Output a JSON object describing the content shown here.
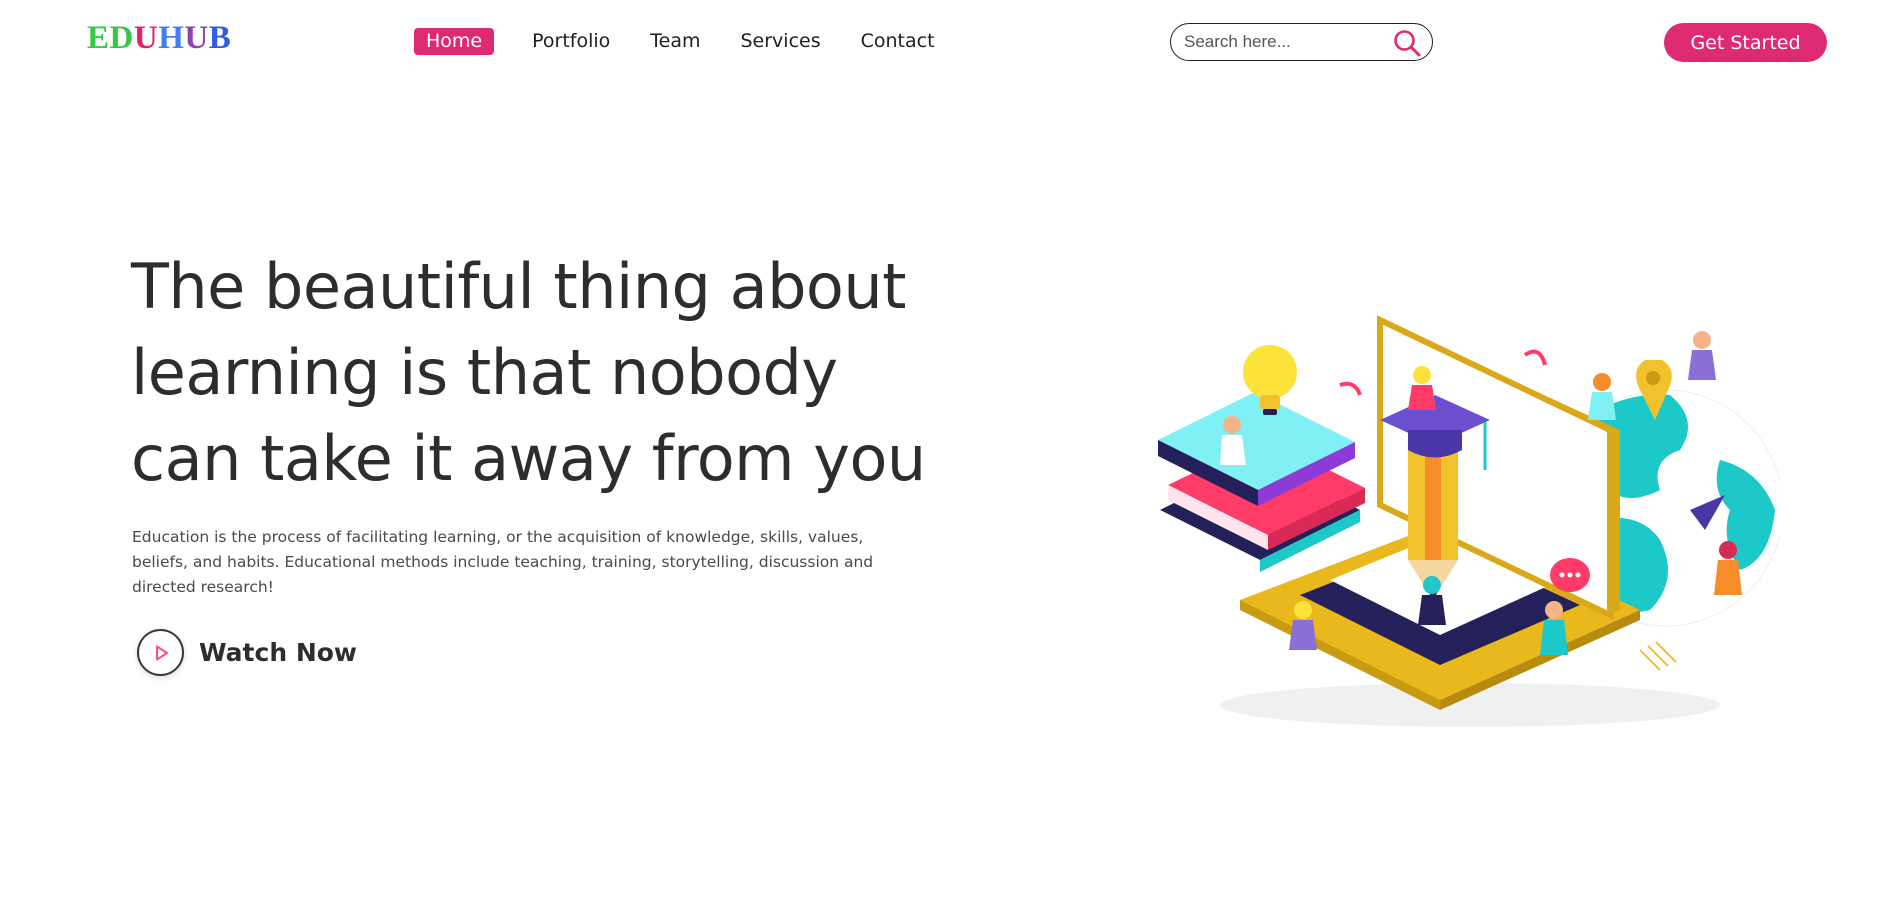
{
  "header": {
    "logo": [
      "E",
      "D",
      "U",
      "H",
      "U",
      "B"
    ],
    "logo_colors": [
      "#2ecc40",
      "#34c84a",
      "#e91e63",
      "#3f7ef5",
      "#8e44ad",
      "#2e5be8"
    ],
    "nav": [
      {
        "label": "Home",
        "active": true
      },
      {
        "label": "Portfolio",
        "active": false
      },
      {
        "label": "Team",
        "active": false
      },
      {
        "label": "Services",
        "active": false
      },
      {
        "label": "Contact",
        "active": false
      }
    ],
    "search_placeholder": "Search here...",
    "cta_label": "Get Started"
  },
  "hero": {
    "title_lines": [
      "The beautiful thing about",
      "learning is that nobody",
      "can take it away from you"
    ],
    "description": "Education is the process of facilitating learning, or the acquisition of knowledge, skills, values, beliefs, and habits. Educational methods include teaching, training, storytelling, discussion and directed research!",
    "watch_label": "Watch Now"
  },
  "icons": {
    "search": "search-icon",
    "play": "play-icon"
  },
  "colors": {
    "accent": "#dd2a72",
    "text": "#2d2d2d",
    "illustration_yellow": "#f2c12e",
    "illustration_teal": "#1dc8c8",
    "illustration_navy": "#24205a"
  }
}
